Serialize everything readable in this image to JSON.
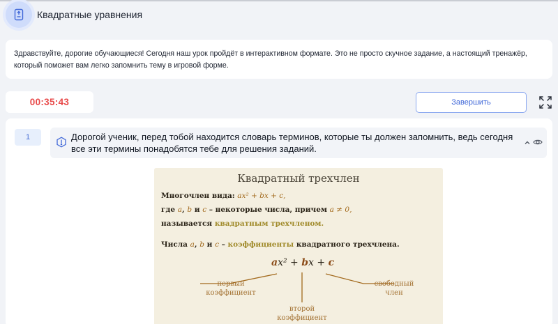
{
  "header": {
    "title": "Квадратные уравнения",
    "icon": "document-icon"
  },
  "intro": {
    "text": "Здравствуйте, дорогие обучающиеся! Сегодня наш урок пройдёт в интерактивном формате. Это не просто скучное задание, а настоящий тренажёр, который поможет вам легко запомнить тему в игровой форме."
  },
  "toolbar": {
    "timer": "00:35:43",
    "finish_label": "Завершить"
  },
  "question": {
    "number": "1",
    "text": "Дорогой ученик, перед тобой находится словарь терминов, которые ты должен запомнить, ведь сегодня все эти термины понадобятся тебе для решения заданий."
  },
  "card": {
    "title": "Квадратный трехчлен",
    "line1_prefix": "Многочлен вида: ",
    "line1_math": "ax² + bx + c,",
    "line2_prefix": "где ",
    "line2_a": "a",
    "line2_sep1": ", ",
    "line2_b": "b",
    "line2_and": " и ",
    "line2_c": "c",
    "line2_rest": " – некоторые числа, причем ",
    "line2_cond": "a ≠ 0,",
    "line3_prefix": "называется ",
    "line3_term": "квадратным трехчленом.",
    "line4_prefix": "Числа ",
    "line4_a": "a",
    "line4_sep1": ", ",
    "line4_b": "b",
    "line4_and": " и ",
    "line4_c": "c",
    "line4_dash": " – ",
    "line4_term": "коэффициенты",
    "line4_rest": " квадратного трехчлена.",
    "formula": {
      "a": "a",
      "x2": "x²",
      "plus1": " + ",
      "b": "b",
      "x": "x",
      "plus2": " + ",
      "c": "c"
    },
    "label_first_1": "первый",
    "label_first_2": "коэффициент",
    "label_second_1": "второй",
    "label_second_2": "коэффициент",
    "label_free_1": "свободный",
    "label_free_2": "член"
  },
  "colors": {
    "timer": "#e84a4a",
    "accent": "#3f67d8",
    "card_bg": "#f4efe0",
    "coefficient": "#a2691c"
  }
}
